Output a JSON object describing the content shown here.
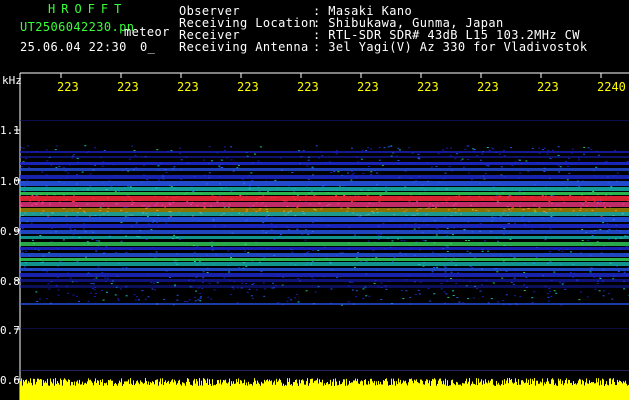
{
  "header": {
    "brand": "HROFFT",
    "file_name": "UT2506042230.pn",
    "kind": "meteor",
    "datetime": "25.06.04 22:30",
    "range_text": "0_",
    "fields": [
      {
        "label": "Observer",
        "value": ": Masaki Kano"
      },
      {
        "label": "Receiving Location",
        "value": ": Shibukawa, Gunma, Japan"
      },
      {
        "label": "Receiver",
        "value": ": RTL-SDR SDR# 43dB L15 103.2MHz CW"
      },
      {
        "label": "Receiving Antenna",
        "value": ": 3el Yagi(V) Az 330 for Vladivostok"
      }
    ]
  },
  "plot": {
    "unit": "kHz",
    "y_labels": [
      "1.1",
      "1.0",
      "0.9",
      "0.8",
      "0.7",
      "0.6"
    ],
    "x_labels": [
      "223",
      "223",
      "223",
      "223",
      "223",
      "223",
      "223",
      "223",
      "223",
      "223",
      "2240"
    ]
  },
  "colors": {
    "background": "#000000",
    "header_green": "#39ff39",
    "label_white": "#ffffff",
    "tick_yellow": "#ffff00",
    "noise_blue": "#1e2ad8",
    "echo_red": "#ff2a3a"
  }
}
